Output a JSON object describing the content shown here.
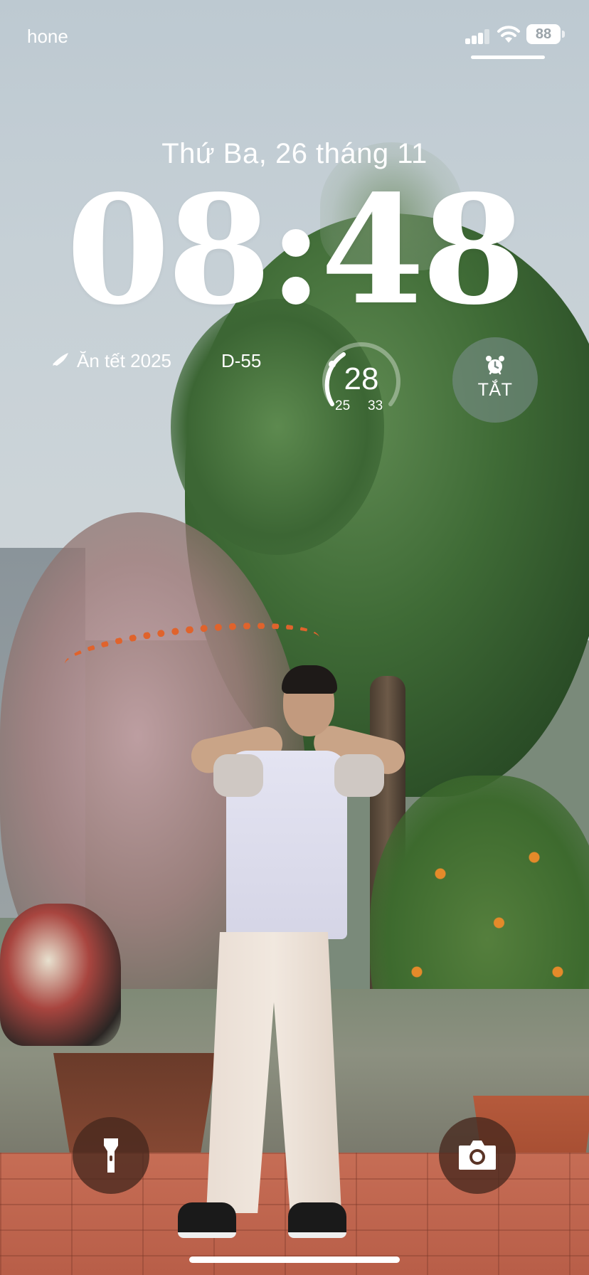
{
  "status_bar": {
    "carrier": "hone",
    "battery": "88"
  },
  "lock_screen": {
    "date": "Thứ Ba, 26 tháng 11",
    "time": "08:48",
    "countdown_widget": {
      "icon": "rocket-icon",
      "label": "Ăn tết 2025",
      "days": "D-55"
    },
    "weather_widget": {
      "current": "28",
      "low": "25",
      "high": "33"
    },
    "alarm_widget": {
      "icon": "alarm-clock-icon",
      "label": "TẮT"
    }
  },
  "quick_actions": {
    "left": "flashlight-icon",
    "right": "camera-icon"
  },
  "colors": {
    "text": "#ffffff",
    "quick_action_bg": "#46281e",
    "alarm_bg": "#788c87"
  }
}
